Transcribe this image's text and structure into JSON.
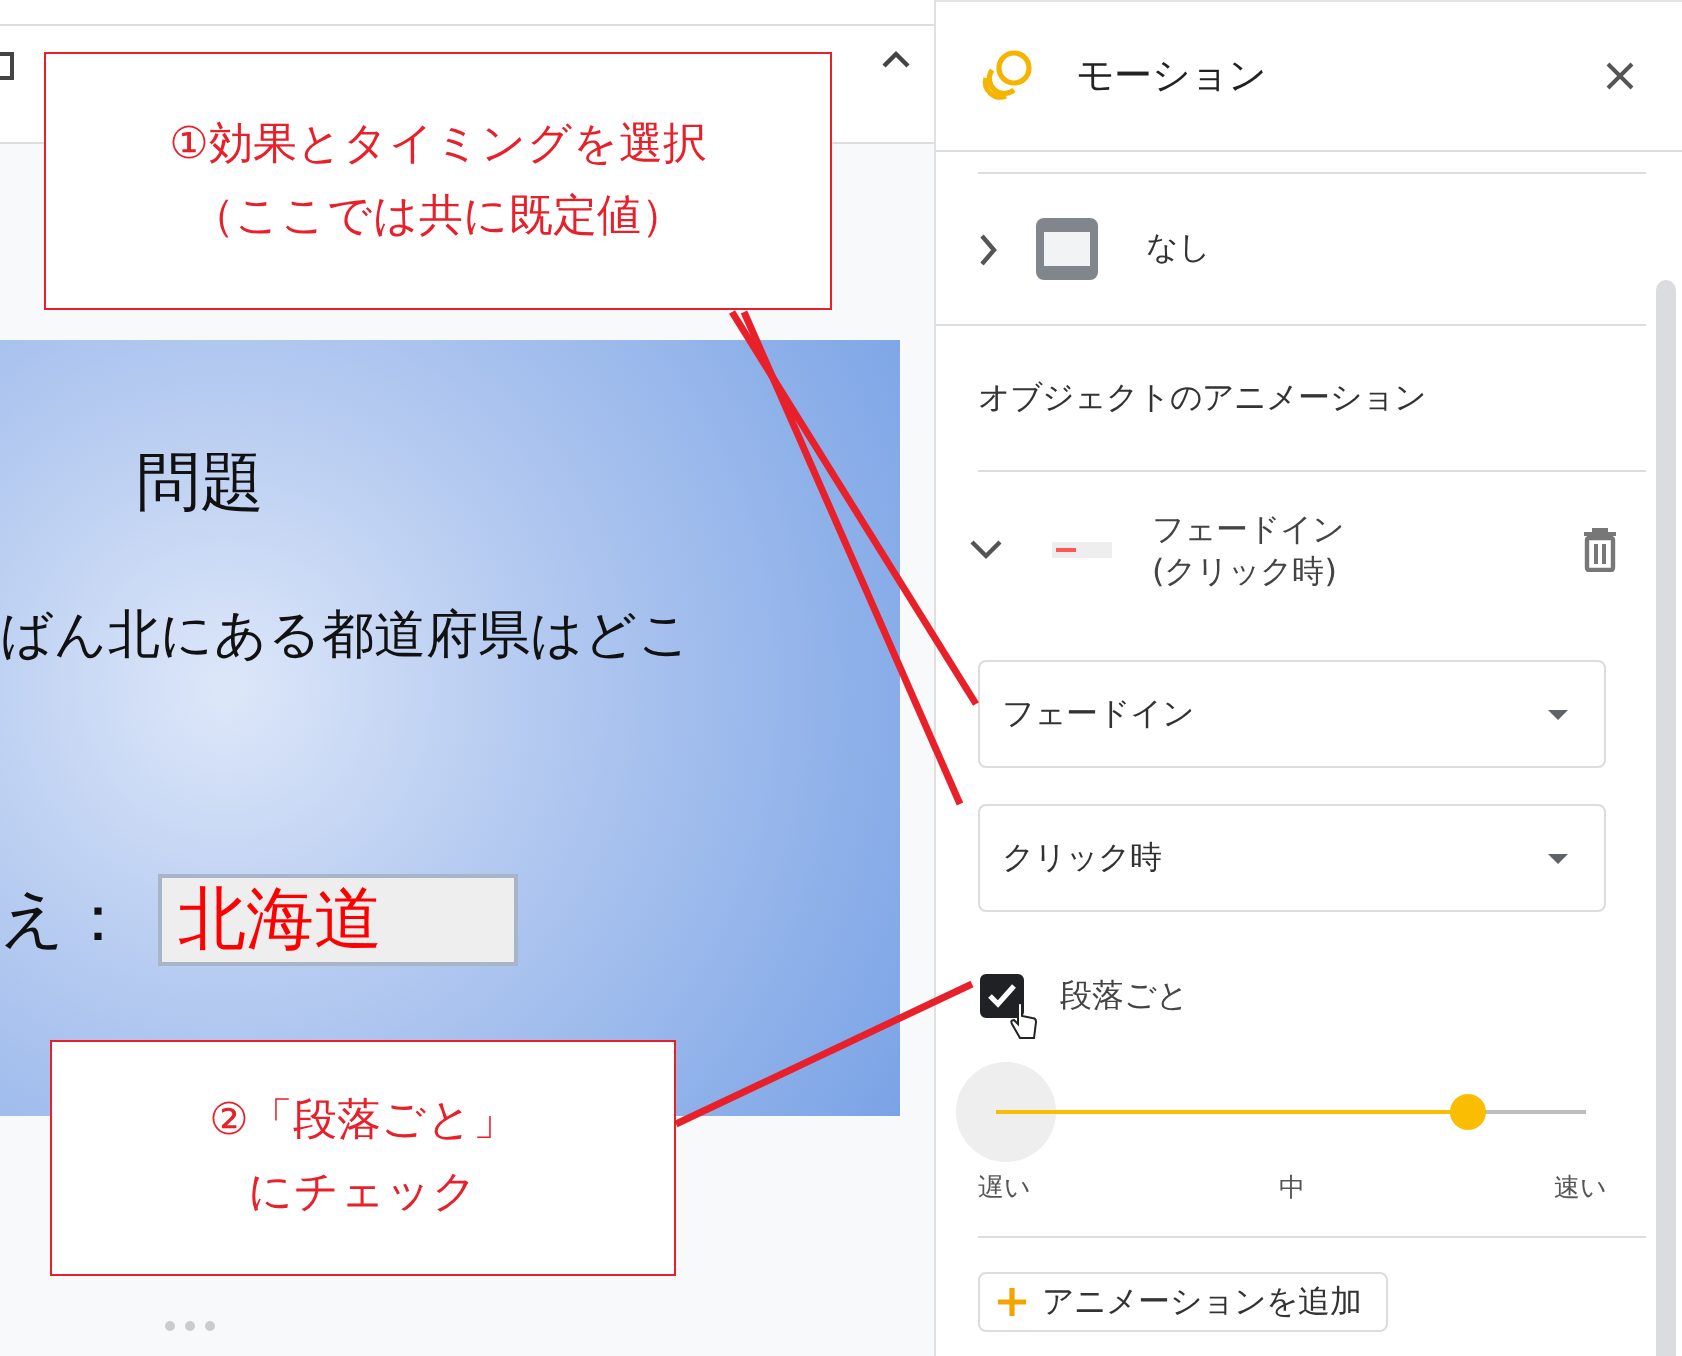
{
  "slide": {
    "title": "問題",
    "question": "ばん北にある都道府県はどこ",
    "answer_label": "え：",
    "answer": "北海道"
  },
  "panel": {
    "title": "モーション",
    "transition": {
      "label": "なし",
      "expanded": false
    },
    "section_title": "オブジェクトのアニメーション",
    "animation": {
      "name": "フェードイン",
      "trigger": "(クリック時)",
      "expanded": true
    },
    "effect_select": {
      "value": "フェードイン"
    },
    "timing_select": {
      "value": "クリック時"
    },
    "by_paragraph": {
      "label": "段落ごと",
      "checked": true
    },
    "speed": {
      "level": 0.8,
      "labels": [
        "遅い",
        "中",
        "速い"
      ]
    },
    "add_button": "アニメーションを追加"
  },
  "callouts": [
    {
      "lines": [
        "①効果とタイミングを選択",
        "（ここでは共に既定値）"
      ]
    },
    {
      "lines": [
        "②「段落ごと」",
        "にチェック"
      ]
    }
  ]
}
